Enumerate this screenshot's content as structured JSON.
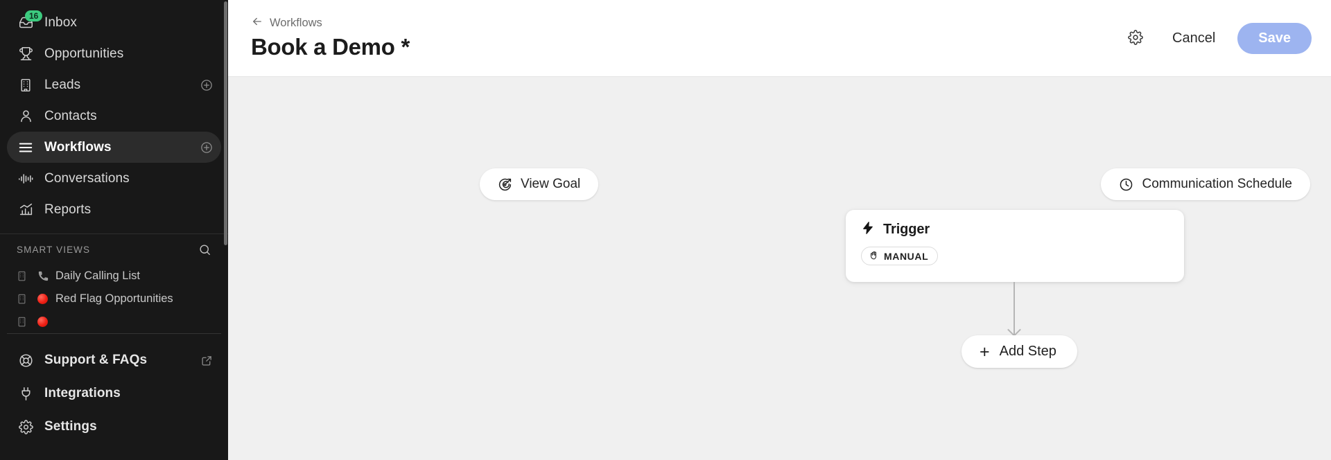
{
  "sidebar": {
    "primary_nav": [
      {
        "label": "Inbox",
        "icon": "inbox-icon",
        "badge": "16",
        "has_add": false,
        "active": false
      },
      {
        "label": "Opportunities",
        "icon": "trophy-icon",
        "badge": null,
        "has_add": false,
        "active": false
      },
      {
        "label": "Leads",
        "icon": "building-icon",
        "badge": null,
        "has_add": true,
        "active": false
      },
      {
        "label": "Contacts",
        "icon": "person-icon",
        "badge": null,
        "has_add": false,
        "active": false
      },
      {
        "label": "Workflows",
        "icon": "hamburger-icon",
        "badge": null,
        "has_add": true,
        "active": true
      },
      {
        "label": "Conversations",
        "icon": "waveform-icon",
        "badge": null,
        "has_add": false,
        "active": false
      },
      {
        "label": "Reports",
        "icon": "bar-chart-icon",
        "badge": null,
        "has_add": false,
        "active": false
      }
    ],
    "smart_views": {
      "title": "SMART VIEWS",
      "search_icon": "search-icon",
      "items": [
        {
          "object_icon": "building-icon",
          "emoji": "telephone-emoji",
          "label": "Daily Calling List"
        },
        {
          "object_icon": "building-icon",
          "emoji": "red-circle-emoji",
          "label": "Red Flag Opportunities"
        },
        {
          "object_icon": "building-icon",
          "emoji": "red-circle-emoji",
          "label": ""
        }
      ]
    },
    "secondary_nav": [
      {
        "label": "Support & FAQs",
        "icon": "lifebuoy-icon",
        "external": true
      },
      {
        "label": "Integrations",
        "icon": "plug-icon",
        "external": false
      },
      {
        "label": "Settings",
        "icon": "gear-icon",
        "external": false
      }
    ],
    "badge_color": "#3ccb7f",
    "background": "#181818",
    "active_item_background": "#2c2c2c"
  },
  "header": {
    "breadcrumb_icon": "arrow-left-icon",
    "breadcrumb_label": "Workflows",
    "title": "Book a Demo *",
    "settings_icon": "gear-icon",
    "cancel_label": "Cancel",
    "save_label": "Save",
    "save_color": "#9db4f0"
  },
  "canvas": {
    "background": "#f0f0f0",
    "view_goal": {
      "label": "View Goal",
      "icon": "goal-target-icon"
    },
    "communication_schedule": {
      "label": "Communication Schedule",
      "icon": "clock-icon"
    },
    "trigger_card": {
      "icon": "lightning-bolt-icon",
      "title": "Trigger",
      "chip_icon": "hand-icon",
      "chip_label": "MANUAL"
    },
    "add_step": {
      "icon": "plus-icon",
      "label": "Add Step"
    },
    "connector_color": "#b5b5b5"
  }
}
